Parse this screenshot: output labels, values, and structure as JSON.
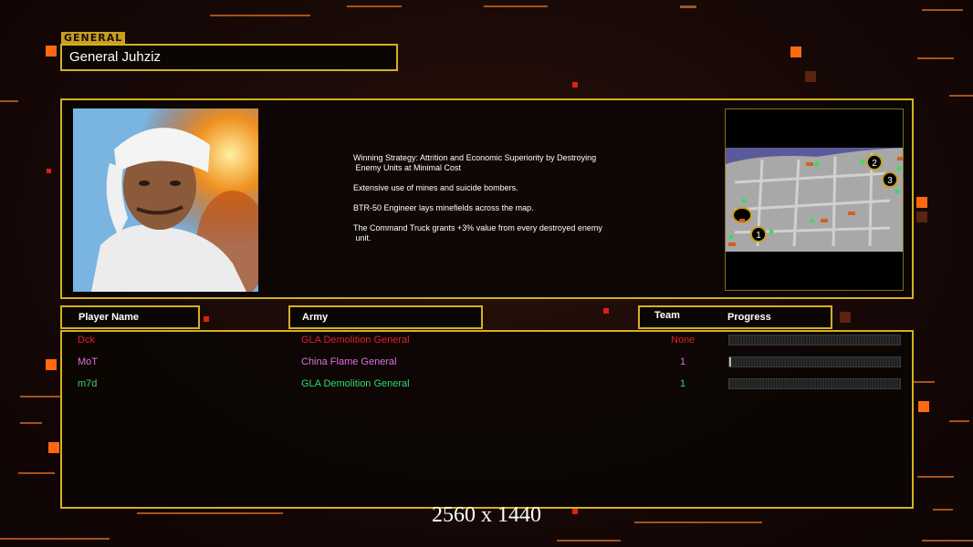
{
  "general": {
    "tag": "GENERAL",
    "name": "General Juhziz",
    "description": [
      "Winning Strategy: Attrition and Economic Superiority by Destroying\n Enemy Units at Minimal Cost",
      "Extensive use of mines and suicide bombers.",
      "BTR-50 Engineer lays minefields across the map.",
      "The Command Truck grants +3% value from every destroyed enemy\n unit."
    ]
  },
  "minimap": {
    "markers": [
      "1",
      "2",
      "3"
    ]
  },
  "headers": {
    "player_name": "Player Name",
    "army": "Army",
    "team": "Team",
    "progress": "Progress"
  },
  "players": [
    {
      "name": "Dck",
      "army": "GLA Demolition General",
      "team": "None",
      "progress": 0,
      "color": "#e0202a"
    },
    {
      "name": "MoT",
      "army": "China Flame General",
      "team": "1",
      "progress": 0.01,
      "color": "#e070e0"
    },
    {
      "name": "m7d",
      "army": "GLA Demolition General",
      "team": "1",
      "progress": 0,
      "color": "#30d870"
    }
  ],
  "resolution_label": "2560 x 1440",
  "colors": {
    "frame": "#d4b020",
    "accent": "#ff6a10"
  }
}
